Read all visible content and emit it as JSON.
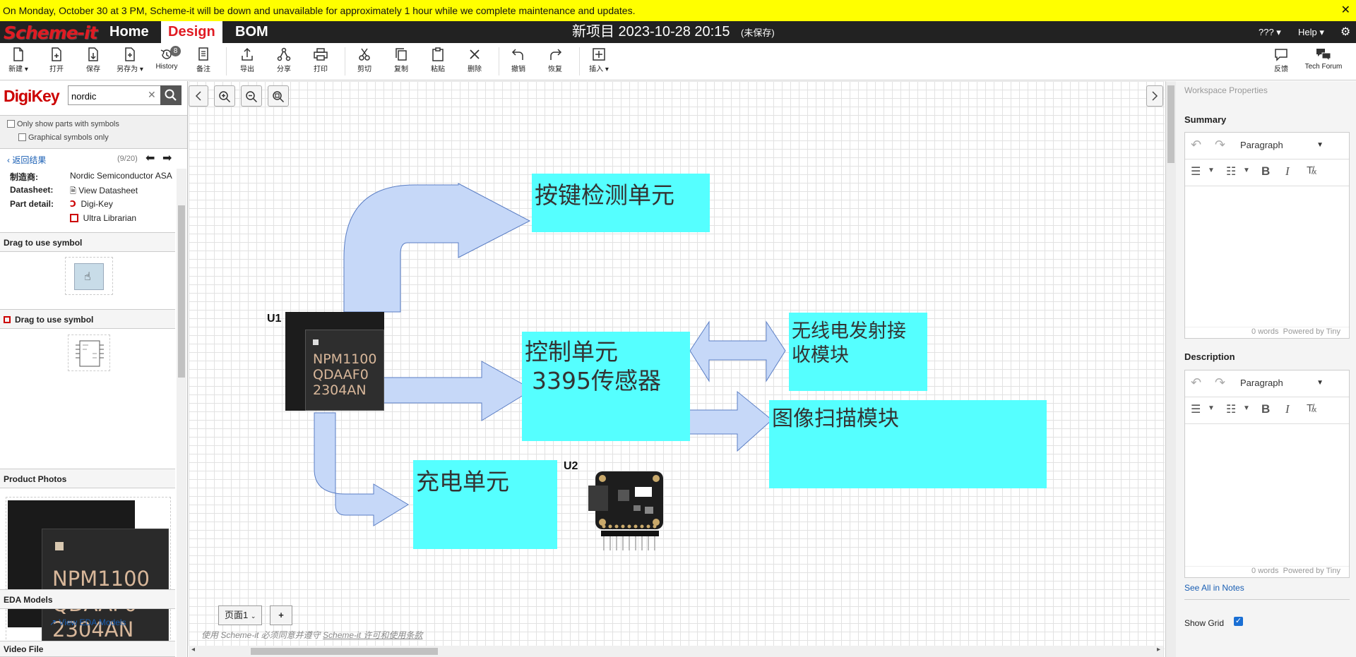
{
  "banner": {
    "message": "On Monday, October 30 at 3 PM, Scheme-it will be down and unavailable for approximately 1 hour while we complete maintenance and updates.",
    "close": "✕"
  },
  "nav": {
    "logo": "Scheme-it",
    "tabs": [
      "Home",
      "Design",
      "BOM"
    ],
    "active_tab": "Design",
    "project_title": "新项目 2023-10-28 20:15",
    "unsaved": "(未保存)",
    "language": "??? ▾",
    "help": "Help ▾"
  },
  "toolbar": {
    "new": "新建 ▾",
    "open": "打开",
    "save": "保存",
    "save_as": "另存为 ▾",
    "history": "History",
    "history_count": "8",
    "notes": "备注",
    "export": "导出",
    "share": "分享",
    "print": "打印",
    "cut": "剪切",
    "copy": "复制",
    "paste": "粘贴",
    "delete": "删除",
    "undo": "撤销",
    "redo": "恢复",
    "insert": "插入 ▾",
    "feedback": "反馈",
    "forum": "Tech Forum"
  },
  "left": {
    "brand": "DigiKey",
    "search": {
      "value": "nordic",
      "placeholder": ""
    },
    "filter1": "Only show parts with symbols",
    "filter2": "Graphical symbols only",
    "back": "返回结果",
    "counter": "(9/20)",
    "details": {
      "mfr_label": "制造商:",
      "mfr_value": "Nordic Semiconductor ASA",
      "ds_label": "Datasheet:",
      "ds_value": "View Datasheet",
      "pd_label": "Part detail:",
      "pd_value1": "Digi-Key",
      "pd_value2": "Ultra Librarian"
    },
    "section_drag1": "Drag to use symbol",
    "section_drag2": "Drag to use symbol",
    "section_photos": "Product Photos",
    "photo_text": [
      "NPM1100",
      "QDAAF0",
      "2304AN"
    ],
    "section_eda": "EDA Models",
    "eda_link": "View EDA Models",
    "section_video": "Video File"
  },
  "canvas": {
    "u1_label": "U1",
    "u2_label": "U2",
    "chip_text": [
      "NPM1100",
      "QDAAF0",
      "2304AN"
    ],
    "box_key": "按键检测单元",
    "box_control_1": "控制单元",
    "box_control_2": "3395传感器",
    "box_wireless_1": "无线电发射接",
    "box_wireless_2": "收模块",
    "box_image": "图像扫描模块",
    "box_charge": "充电单元",
    "page_tab": "页面1",
    "add_page": "+",
    "terms_pre": "使用 Scheme-it 必须同意并遵守 ",
    "terms_link": "Scheme-it 许可和使用条款"
  },
  "right": {
    "title": "Workspace Properties",
    "summary": "Summary",
    "description": "Description",
    "paragraph": "Paragraph",
    "words": "0 words",
    "powered": "Powered by Tiny",
    "see_all": "See All in Notes",
    "show_grid": "Show Grid"
  },
  "colors": {
    "accent": "#e01b23",
    "box": "#55ffff",
    "arrow": "#c6d8f8",
    "banner": "#ffff00"
  }
}
